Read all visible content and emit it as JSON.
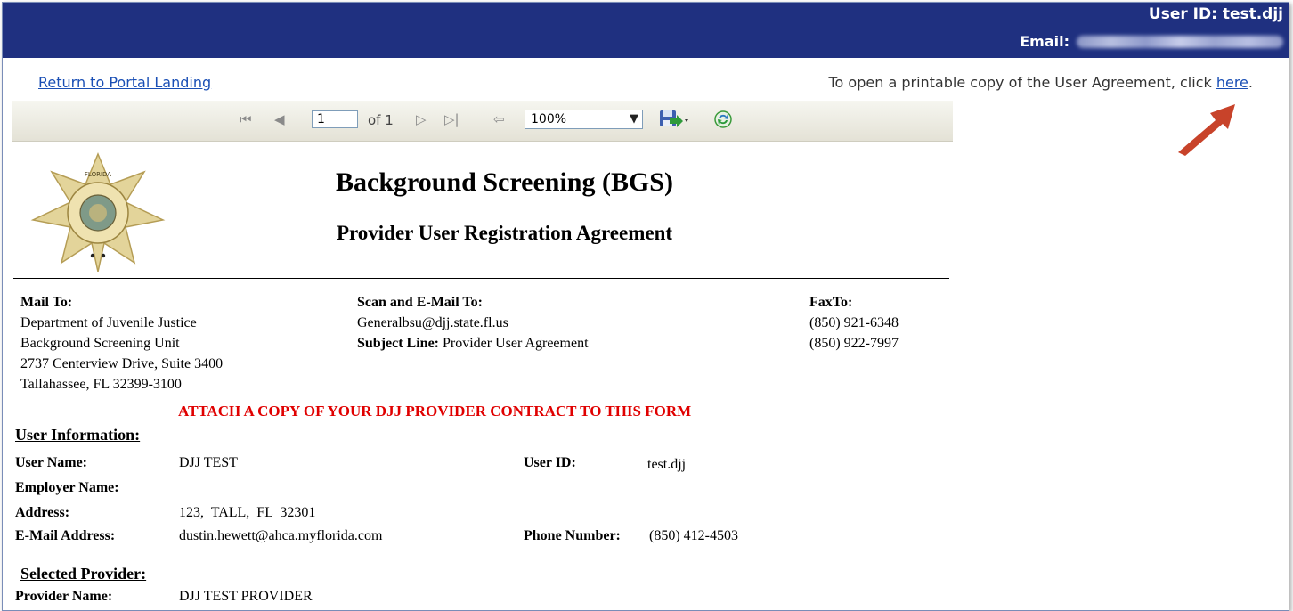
{
  "header": {
    "user_id_text": "User ID: test.djj",
    "email_label": "Email:"
  },
  "links": {
    "return_portal": "Return to Portal Landing",
    "printable_prefix": "To open a printable copy of the User Agreement, click ",
    "printable_link": "here",
    "printable_suffix": "."
  },
  "toolbar": {
    "first_page": "⏮",
    "prev_page": "◀",
    "page_value": "1",
    "of_text": "of 1",
    "next_page": "▷",
    "last_page": "▷|",
    "back": "⇦",
    "zoom_value": "100%",
    "zoom_options": [
      "100%"
    ]
  },
  "document": {
    "title": "Background Screening (BGS)",
    "subtitle": "Provider User Registration Agreement",
    "badge_text_top": "FLORIDA",
    "badge_text_ring": "DEPARTMENT OF JUVENILE JUSTICE",
    "mail_to": {
      "heading": "Mail To:",
      "lines": [
        "Department of Juvenile Justice",
        "Background Screening Unit",
        "2737 Centerview Drive, Suite 3400",
        "Tallahassee, FL 32399-3100"
      ]
    },
    "scan_email": {
      "heading": "Scan and E-Mail To:",
      "email": "Generalbsu@djj.state.fl.us",
      "subject_label": "Subject Line:",
      "subject_value": "Provider User Agreement"
    },
    "fax_to": {
      "heading": "FaxTo:",
      "lines": [
        "(850) 921-6348",
        "(850) 922-7997"
      ]
    },
    "attach_notice": "ATTACH A COPY OF YOUR DJJ PROVIDER CONTRACT TO THIS FORM",
    "user_info": {
      "heading": "User Information:",
      "user_name_label": "User Name:",
      "user_name": "DJJ TEST",
      "user_id_label": "User ID:",
      "user_id": "test.djj",
      "employer_label": "Employer Name:",
      "address_label": "Address:",
      "address": "123,  TALL,  FL  32301",
      "email_label": "E-Mail Address:",
      "email": "dustin.hewett@ahca.myflorida.com",
      "phone_label": "Phone Number:",
      "phone": "(850) 412-4503"
    },
    "selected_provider": {
      "heading": "Selected Provider:",
      "provider_label": "Provider Name:",
      "provider_name": "DJJ TEST PROVIDER"
    }
  }
}
